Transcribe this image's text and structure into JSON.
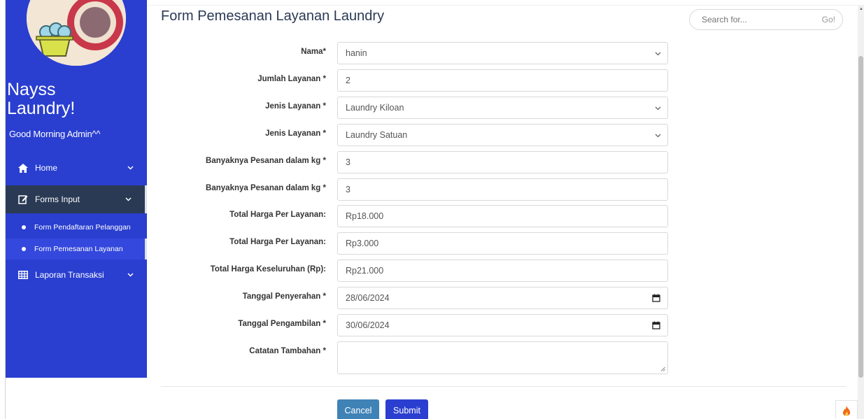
{
  "sidebar": {
    "brand": "Nayss\nLaundry!",
    "brand_line1": "Nayss",
    "brand_line2": "Laundry!",
    "greeting": "Good Morning Admin^^",
    "nav": {
      "home": "Home",
      "forms_input": "Forms Input",
      "form_pendaftaran": "Form Pendaftaran Pelanggan",
      "form_pemesanan": "Form Pemesanan Layanan",
      "laporan": "Laporan Transaksi"
    }
  },
  "header": {
    "title": "Form Pemesanan Layanan Laundry",
    "search_placeholder": "Search for...",
    "search_go": "Go!"
  },
  "form": {
    "nama": {
      "label": "Nama*",
      "value": "hanin"
    },
    "jumlah": {
      "label": "Jumlah Layanan *",
      "value": "2"
    },
    "jenis1": {
      "label": "Jenis Layanan *",
      "value": "Laundry Kiloan"
    },
    "jenis2": {
      "label": "Jenis Layanan *",
      "value": "Laundry Satuan"
    },
    "kg1": {
      "label": "Banyaknya Pesanan dalam kg *",
      "value": "3"
    },
    "kg2": {
      "label": "Banyaknya Pesanan dalam kg *",
      "value": "3"
    },
    "harga1": {
      "label": "Total Harga Per Layanan:",
      "value": "Rp18.000"
    },
    "harga2": {
      "label": "Total Harga Per Layanan:",
      "value": "Rp3.000"
    },
    "total": {
      "label": "Total Harga Keseluruhan (Rp):",
      "value": "Rp21.000"
    },
    "penyerahan": {
      "label": "Tanggal Penyerahan *",
      "value": "28/06/2024"
    },
    "pengambilan": {
      "label": "Tanggal Pengambilan *",
      "value": "30/06/2024"
    },
    "catatan": {
      "label": "Catatan Tambahan *",
      "value": ""
    }
  },
  "buttons": {
    "cancel": "Cancel",
    "submit": "Submit"
  },
  "colors": {
    "sidebar_bg": "#2a3fd0",
    "active_section": "#2a3a55",
    "cancel_btn": "#3f82b6",
    "submit_btn": "#2a3fd0"
  }
}
